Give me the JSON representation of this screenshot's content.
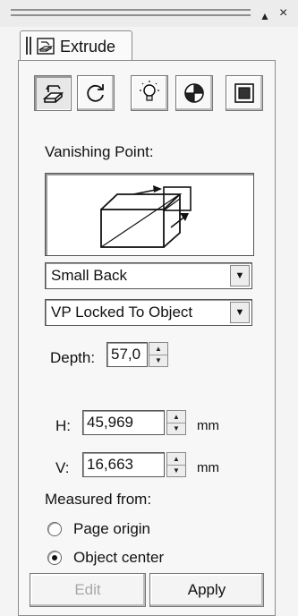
{
  "titlebar": {
    "pin_glyph": "▲",
    "close_glyph": "×"
  },
  "tab": {
    "label": "Extrude",
    "icon": "extrude-docker-icon"
  },
  "toolbar": {
    "buttons": [
      {
        "icon": "extrude-shape-icon",
        "active": true
      },
      {
        "icon": "rotate-icon",
        "active": false
      },
      {
        "icon": "lighting-bulb-icon",
        "active": false
      },
      {
        "icon": "color-wheel-icon",
        "active": false
      },
      {
        "icon": "bevel-square-icon",
        "active": false
      }
    ]
  },
  "vanishing_point": {
    "label": "Vanishing Point:",
    "type_value": "Small Back",
    "lock_value": "VP Locked To Object"
  },
  "depth": {
    "label": "Depth:",
    "value": "57,0"
  },
  "h": {
    "label": "H:",
    "value": "45,969",
    "unit": "mm"
  },
  "v": {
    "label": "V:",
    "value": "16,663",
    "unit": "mm"
  },
  "measured_from": {
    "label": "Measured from:",
    "options": [
      {
        "label": "Page origin",
        "selected": false
      },
      {
        "label": "Object center",
        "selected": true
      }
    ]
  },
  "buttons": {
    "edit": "Edit",
    "apply": "Apply"
  }
}
